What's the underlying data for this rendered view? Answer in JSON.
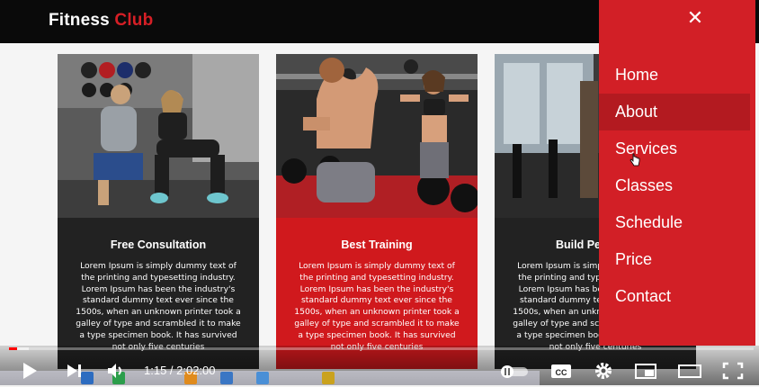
{
  "site": {
    "brand_part1": "Fitness ",
    "brand_part2": "Club"
  },
  "cards": [
    {
      "title": "Free Consultation",
      "text": "Lorem Ipsum is simply dummy text of the printing and typesetting industry. Lorem Ipsum has been the industry's standard dummy text ever since the 1500s, when an unknown printer took a galley of type and scrambled it to make a type specimen book. It has survived not only five centuries"
    },
    {
      "title": "Best Training",
      "text": "Lorem Ipsum is simply dummy text of the printing and typesetting industry. Lorem Ipsum has been the industry's standard dummy text ever since the 1500s, when an unknown printer took a galley of type and scrambled it to make a type specimen book. It has survived not only five centuries"
    },
    {
      "title": "Build Perf",
      "text": "Lorem Ipsum is simply dummy text of the printing and typesetting industry. Lorem Ipsum has been the industry's standard dummy text ever since the 1500s, when an unknown printer took a galley of type and scrambled it to make a type specimen book. It has survived not only five centuries"
    }
  ],
  "menu": {
    "close_glyph": "✕",
    "items": [
      "Home",
      "About",
      "Services",
      "Classes",
      "Schedule",
      "Price",
      "Contact"
    ],
    "active_item": "About"
  },
  "player": {
    "time": "1:15 / 2:02:00",
    "progress": 0.0103,
    "buffered": 0.026,
    "icons": [
      "play-icon",
      "next-icon",
      "volume-icon",
      "autoplay-toggle-icon",
      "captions-icon",
      "settings-icon",
      "miniplayer-icon",
      "theater-icon",
      "fullscreen-icon"
    ]
  },
  "colors": {
    "accent": "#d21f26",
    "card_dark": "#222222",
    "card_red": "#d0191d",
    "topbar": "#0a0a0a",
    "progress": "#ff0000"
  }
}
